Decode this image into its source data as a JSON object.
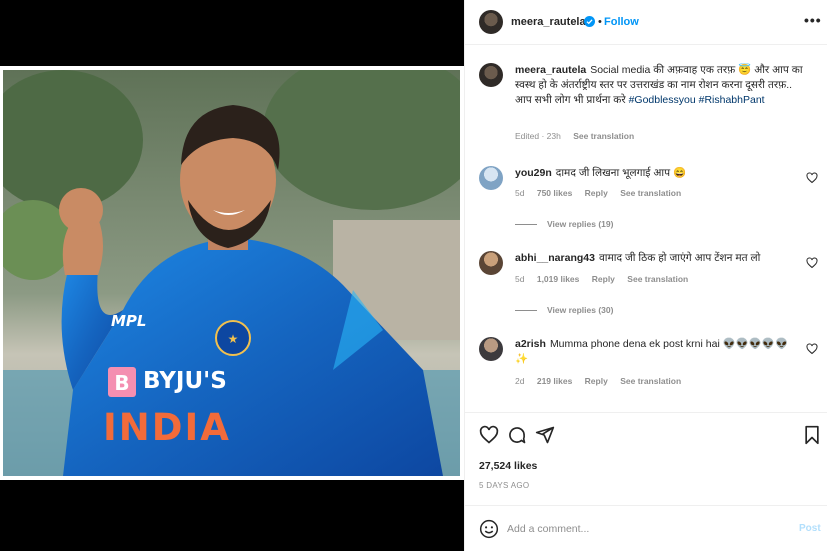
{
  "post": {
    "username": "meera_rautela",
    "follow_label": "Follow",
    "more_icon": "more-horizontal-icon",
    "caption_text": "Social media की अफ़वाह एक तरफ़ 😇 और आप का स्वस्थ हो के अंतर्राष्ट्रीय स्तर पर उत्तराखंड का नाम रोशन करना दूसरी तरफ़..",
    "caption_line2": "आप सभी लोग भी प्रार्थना करे",
    "hashtags": "#Godblessyou #RishabhPant",
    "edited": "Edited · 23h",
    "see_translation": "See translation"
  },
  "photo": {
    "jersey_sponsor": "BYJU'S",
    "jersey_text": "INDIA",
    "jersey_brand": "MPL"
  },
  "comments": [
    {
      "username": "you29n",
      "text": "दामद जी लिखना भूलगाई आप 😄",
      "age": "5d",
      "likes": "750 likes",
      "reply": "Reply",
      "see_translation": "See translation",
      "view_replies": "View replies (19)"
    },
    {
      "username": "abhi__narang43",
      "text": "वामाद जी ठिक हो जाएंगे आप टेंशन मत लो",
      "age": "5d",
      "likes": "1,019 likes",
      "reply": "Reply",
      "see_translation": "See translation",
      "view_replies": "View replies (30)"
    },
    {
      "username": "a2rish",
      "text": "Mumma phone dena ek post krni hai 👽👽👽👽👽 ✨",
      "age": "2d",
      "likes": "219 likes",
      "reply": "Reply",
      "see_translation": "See translation"
    }
  ],
  "actions": {
    "like_icon": "heart-icon",
    "comment_icon": "comment-icon",
    "share_icon": "share-icon",
    "save_icon": "bookmark-icon",
    "likes": "27,524 likes",
    "time_ago": "5 DAYS AGO"
  },
  "composer": {
    "placeholder": "Add a comment...",
    "post_label": "Post"
  },
  "colors": {
    "link": "#0095f6",
    "muted": "#8e8e8e",
    "jersey_blue": "#1565c0",
    "jersey_orange": "#f26b3a"
  }
}
